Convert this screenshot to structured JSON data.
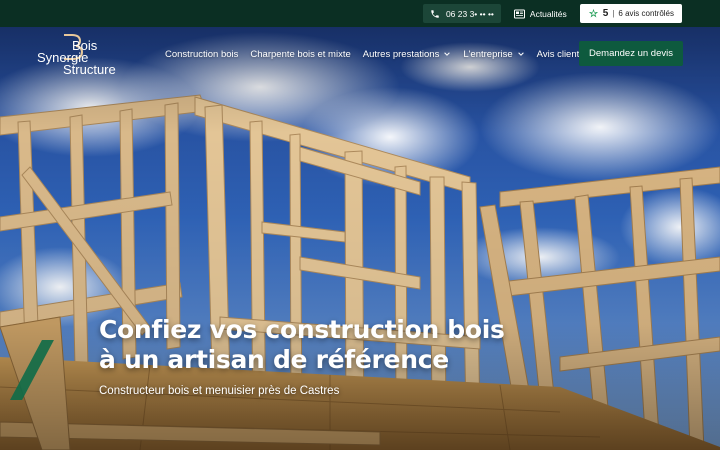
{
  "topbar": {
    "phone": "06 23 3• •• ••",
    "news_label": "Actualités",
    "reviews": {
      "score": "5",
      "separator": "|",
      "text": "6 avis contrôlés"
    }
  },
  "brand": {
    "line1": "Bois",
    "line2": "Synergie",
    "line3": "Structure"
  },
  "nav": {
    "items": [
      {
        "label": "Construction bois",
        "has_dropdown": false
      },
      {
        "label": "Charpente bois et mixte",
        "has_dropdown": false
      },
      {
        "label": "Autres prestations",
        "has_dropdown": true
      },
      {
        "label": "L'entreprise",
        "has_dropdown": true
      },
      {
        "label": "Avis clients",
        "has_dropdown": false
      }
    ],
    "cta_label": "Demandez un devis"
  },
  "hero": {
    "headline_line1": "Confiez vos construction bois",
    "headline_line2": "à un artisan de référence",
    "subline": "Constructeur bois et menuisier près de Castres"
  },
  "icons": {
    "phone": "phone-icon",
    "news": "newspaper-icon",
    "reviews": "star-icon",
    "dropdown": "chevron-down-icon"
  },
  "colors": {
    "topbar_bg": "#0b2f23",
    "cta_bg": "#0e5a3e",
    "accent": "#0e6b48"
  }
}
